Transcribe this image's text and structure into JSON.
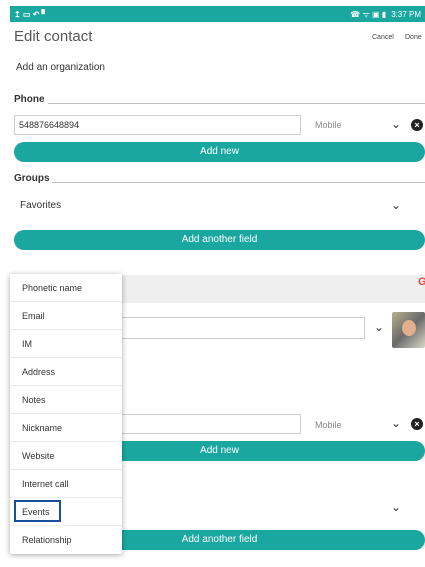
{
  "status_bar": {
    "left_icons": "↥ ▭ ↶ ▘",
    "right_text": "3:37 PM",
    "right_icons": "☎ ᯤ ▣ ▮"
  },
  "header": {
    "title": "Edit contact",
    "cancel": "Cancel",
    "done": "Done"
  },
  "organization": "Add an organization",
  "phone_section": {
    "label": "Phone",
    "number": "548876648894",
    "type": "Mobile",
    "add_new": "Add new"
  },
  "groups_section": {
    "label": "Groups",
    "value": "Favorites",
    "add_field": "Add another field"
  },
  "background": {
    "phone_type": "Mobile",
    "add_new": "Add new",
    "add_field": "Add another field"
  },
  "menu": {
    "items": [
      "Phonetic name",
      "Email",
      "IM",
      "Address",
      "Notes",
      "Nickname",
      "Website",
      "Internet call",
      "Events",
      "Relationship"
    ],
    "highlighted": "Events"
  },
  "colors": {
    "accent": "#19a7a0",
    "highlight_border": "#1b4f9c"
  }
}
